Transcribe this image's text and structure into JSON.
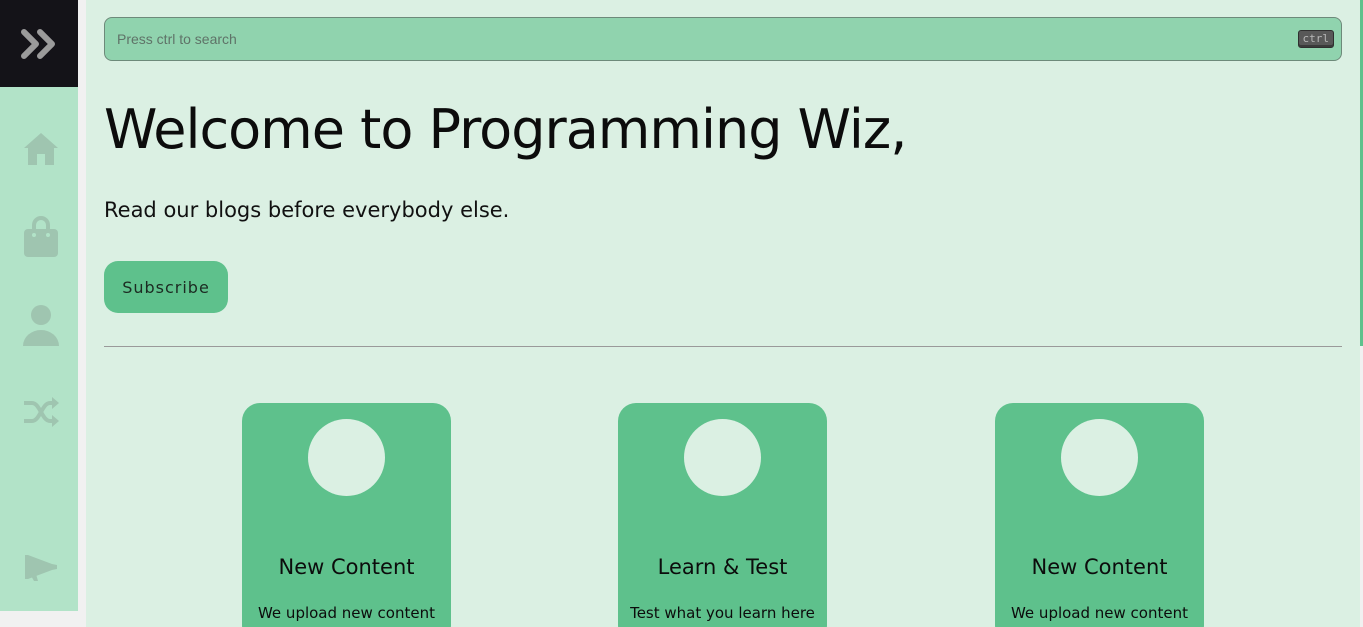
{
  "sidebar": {
    "toggle_icon": "double-chevron-right-icon",
    "items": [
      {
        "icon": "home-icon"
      },
      {
        "icon": "shopping-bag-icon"
      },
      {
        "icon": "user-icon"
      },
      {
        "icon": "shuffle-icon"
      },
      {
        "icon": "megaphone-icon"
      }
    ]
  },
  "search": {
    "placeholder": "Press ctrl to search",
    "shortcut": "ctrl"
  },
  "hero": {
    "title": "Welcome to Programming Wiz,",
    "subtitle": "Read our blogs before everybody else.",
    "button_label": "Subscribe"
  },
  "cards": [
    {
      "title": "New Content",
      "text": "We upload new content"
    },
    {
      "title": "Learn & Test",
      "text": "Test what you learn here"
    },
    {
      "title": "New Content",
      "text": "We upload new content"
    }
  ],
  "colors": {
    "sidebar_bg": "#b2e3c8",
    "toggle_bg": "#141318",
    "main_bg": "#dbf0e3",
    "accent": "#5ec18c",
    "search_bg": "#90d3ae"
  }
}
